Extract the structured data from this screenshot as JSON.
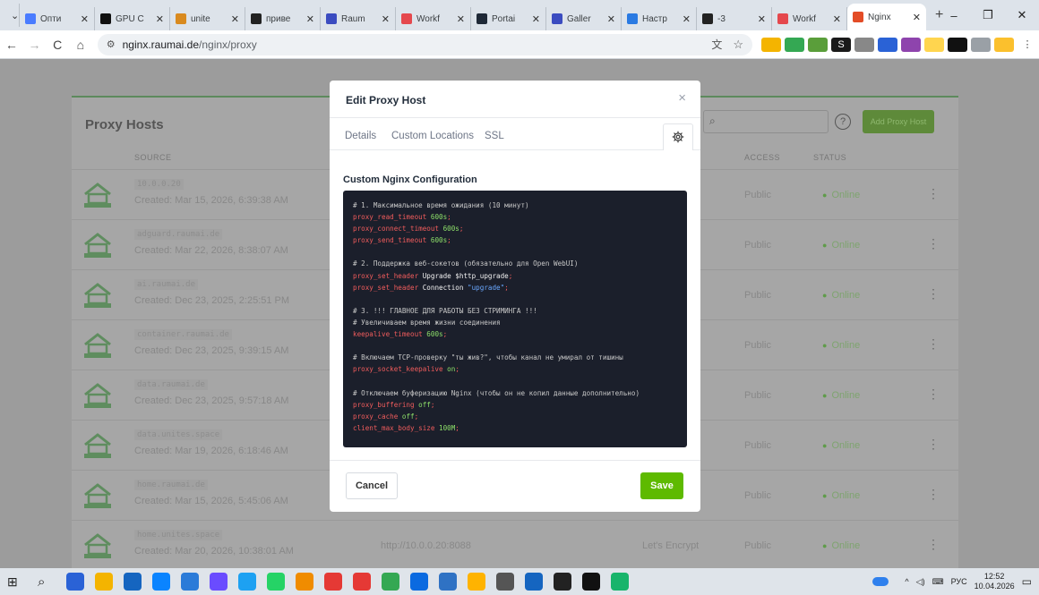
{
  "browser": {
    "tabs": [
      {
        "label": "Опти",
        "color": "#4a7cff",
        "active": false
      },
      {
        "label": "GPU C",
        "color": "#111111",
        "active": false
      },
      {
        "label": "unite",
        "color": "#d98a1f",
        "active": false
      },
      {
        "label": "приве",
        "color": "#222222",
        "active": false
      },
      {
        "label": "Raum",
        "color": "#3b4cc0",
        "active": false
      },
      {
        "label": "Workf",
        "color": "#e5484d",
        "active": false
      },
      {
        "label": "Portai",
        "color": "#1f2937",
        "active": false
      },
      {
        "label": "Galler",
        "color": "#3b4cc0",
        "active": false
      },
      {
        "label": "Настр",
        "color": "#2a7ae2",
        "active": false
      },
      {
        "label": "-3",
        "color": "#222222",
        "active": false
      },
      {
        "label": "Workf",
        "color": "#e5484d",
        "active": false
      },
      {
        "label": "Nginx",
        "color": "#e34c26",
        "active": true
      }
    ],
    "new_tab": "+",
    "url_host": "nginx.raumai.de",
    "url_path": "/nginx/proxy",
    "back": "←",
    "forward": "→",
    "reload": "C",
    "home": "⌂"
  },
  "page": {
    "title": "Proxy Hosts",
    "add_button": "Add Proxy Host",
    "help": "?",
    "search_icon": "search-icon",
    "columns": {
      "source": "SOURCE",
      "access": "ACCESS",
      "status": "STATUS"
    },
    "rows": [
      {
        "domain": "10.0.0.20",
        "created": "Created: Mar 15, 2026, 6:39:38 AM",
        "destination": "",
        "ssl": "",
        "access": "Public",
        "status": "Online"
      },
      {
        "domain": "adguard.raumai.de",
        "created": "Created: Mar 22, 2026, 8:38:07 AM",
        "destination": "",
        "ssl": "",
        "access": "Public",
        "status": "Online"
      },
      {
        "domain": "ai.raumai.de",
        "created": "Created: Dec 23, 2025, 2:25:51 PM",
        "destination": "",
        "ssl": "",
        "access": "Public",
        "status": "Online"
      },
      {
        "domain": "container.raumai.de",
        "created": "Created: Dec 23, 2025, 9:39:15 AM",
        "destination": "",
        "ssl": "",
        "access": "Public",
        "status": "Online"
      },
      {
        "domain": "data.raumai.de",
        "created": "Created: Dec 23, 2025, 9:57:18 AM",
        "destination": "",
        "ssl": "",
        "access": "Public",
        "status": "Online"
      },
      {
        "domain": "data.unites.space",
        "created": "Created: Mar 19, 2026, 6:18:46 AM",
        "destination": "",
        "ssl": "",
        "access": "Public",
        "status": "Online"
      },
      {
        "domain": "home.raumai.de",
        "created": "Created: Mar 15, 2026, 5:45:06 AM",
        "destination": "",
        "ssl": "",
        "access": "Public",
        "status": "Online"
      },
      {
        "domain": "home.unites.space",
        "created": "Created: Mar 20, 2026, 10:38:01 AM",
        "destination": "http://10.0.0.20:8088",
        "ssl": "Let's Encrypt",
        "access": "Public",
        "status": "Online"
      }
    ]
  },
  "modal": {
    "title": "Edit Proxy Host",
    "close": "×",
    "tabs": {
      "details": "Details",
      "custom_locations": "Custom Locations",
      "ssl": "SSL"
    },
    "config_label": "Custom Nginx Configuration",
    "code": [
      [
        {
          "t": "# 1. Максимальное время ожидания (10 минут)",
          "c": "com"
        }
      ],
      [
        {
          "t": "proxy_read_timeout",
          "c": "key"
        },
        {
          "t": " 600s",
          "c": "num"
        },
        {
          "t": ";",
          "c": "key"
        }
      ],
      [
        {
          "t": "proxy_connect_timeout",
          "c": "key"
        },
        {
          "t": " 600s",
          "c": "num"
        },
        {
          "t": ";",
          "c": "key"
        }
      ],
      [
        {
          "t": "proxy_send_timeout",
          "c": "key"
        },
        {
          "t": " 600s",
          "c": "num"
        },
        {
          "t": ";",
          "c": "key"
        }
      ],
      [
        {
          "t": "",
          "c": "com"
        }
      ],
      [
        {
          "t": "# 2. Поддержка веб-сокетов (обязательно для Open WebUI)",
          "c": "com"
        }
      ],
      [
        {
          "t": "proxy_set_header",
          "c": "key"
        },
        {
          "t": " Upgrade ",
          "c": "arg"
        },
        {
          "t": "$http_upgrade",
          "c": "var"
        },
        {
          "t": ";",
          "c": "key"
        }
      ],
      [
        {
          "t": "proxy_set_header",
          "c": "key"
        },
        {
          "t": " Connection ",
          "c": "arg"
        },
        {
          "t": "\"upgrade\"",
          "c": "str"
        },
        {
          "t": ";",
          "c": "key"
        }
      ],
      [
        {
          "t": "",
          "c": "com"
        }
      ],
      [
        {
          "t": "# 3. !!! ГЛАВНОЕ ДЛЯ РАБОТЫ БЕЗ СТРИМИНГА !!!",
          "c": "com"
        }
      ],
      [
        {
          "t": "# Увеличиваем время жизни соединения",
          "c": "com"
        }
      ],
      [
        {
          "t": "keepalive_timeout",
          "c": "key"
        },
        {
          "t": " 600s",
          "c": "num"
        },
        {
          "t": ";",
          "c": "key"
        }
      ],
      [
        {
          "t": "",
          "c": "com"
        }
      ],
      [
        {
          "t": "# Включаем TCP-проверку \"ты жив?\", чтобы канал не умирал от тишины",
          "c": "com"
        }
      ],
      [
        {
          "t": "proxy_socket_keepalive",
          "c": "key"
        },
        {
          "t": " on",
          "c": "num"
        },
        {
          "t": ";",
          "c": "key"
        }
      ],
      [
        {
          "t": "",
          "c": "com"
        }
      ],
      [
        {
          "t": "# Отключаем буферизацию Nginx (чтобы он не копил данные дополнительно)",
          "c": "com"
        }
      ],
      [
        {
          "t": "proxy_buffering",
          "c": "key"
        },
        {
          "t": " off",
          "c": "num"
        },
        {
          "t": ";",
          "c": "key"
        }
      ],
      [
        {
          "t": "proxy_cache",
          "c": "key"
        },
        {
          "t": " off",
          "c": "num"
        },
        {
          "t": ";",
          "c": "key"
        }
      ],
      [
        {
          "t": "client_max_body_size",
          "c": "key"
        },
        {
          "t": " 100M",
          "c": "num"
        },
        {
          "t": ";",
          "c": "key"
        }
      ]
    ],
    "cancel": "Cancel",
    "save": "Save"
  },
  "taskbar": {
    "time": "12:52",
    "date": "10.04.2026",
    "lang": "РУС",
    "icons": [
      "#2a62d6",
      "#f4b400",
      "#1565c0",
      "#0a84ff",
      "#2b7bd8",
      "#6a4cff",
      "#1da1f2",
      "#25d366",
      "#f08c00",
      "#e53935",
      "#e53935",
      "#34a853",
      "#0b6ae0",
      "#2f72c4",
      "#ffb300",
      "#555555",
      "#1565c0",
      "#222222",
      "#111111",
      "#18b46b"
    ]
  },
  "colors": {
    "accent_green": "#5eba00",
    "code_bg": "#1b1f2b"
  }
}
